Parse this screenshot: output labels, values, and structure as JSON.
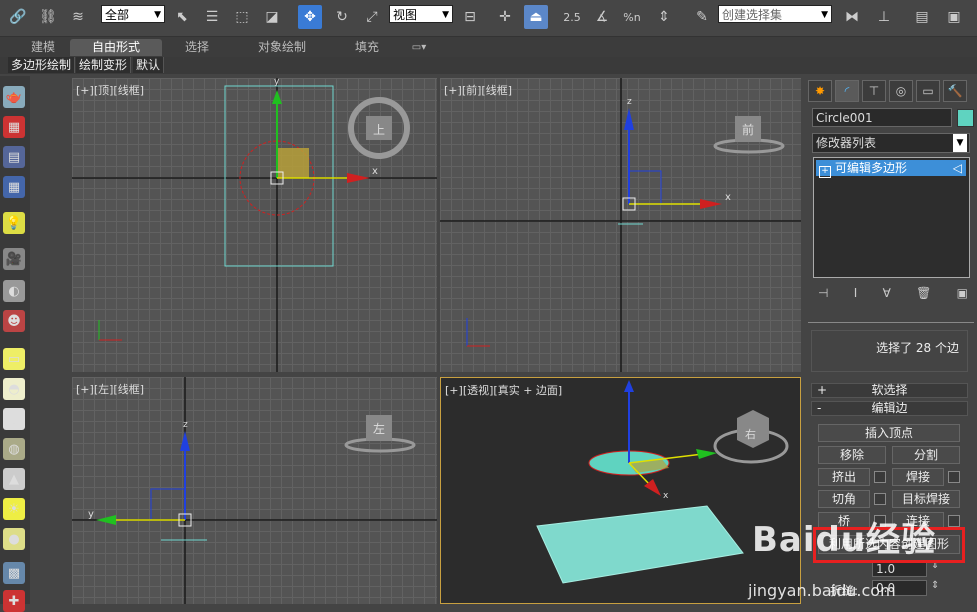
{
  "toolbar": {
    "selection_filter": "全部",
    "ref_coord": "视图",
    "named_selection": "创建选择集",
    "snap_2d_label": "2.5",
    "percent_snap_label": "%n"
  },
  "ribbon": {
    "tabs": [
      "建模",
      "自由形式",
      "选择",
      "对象绘制",
      "填充"
    ],
    "selected_tab": "自由形式",
    "subtabs": [
      "多边形绘制",
      "绘制变形",
      "默认"
    ]
  },
  "viewports": {
    "top": {
      "label_plus": "[+]",
      "label_view": "[顶]",
      "label_shade": "[线框]",
      "cube_label": "上"
    },
    "front": {
      "label_plus": "[+]",
      "label_view": "[前]",
      "label_shade": "[线框]",
      "cube_label": "前"
    },
    "left": {
      "label_plus": "[+]",
      "label_view": "[左]",
      "label_shade": "[线框]",
      "cube_label": "左"
    },
    "persp": {
      "label_plus": "[+]",
      "label_view": "[透视]",
      "label_shade": "[真实 + 边面]",
      "cube_label": "右"
    }
  },
  "axes": {
    "x": "x",
    "y": "y",
    "z": "z"
  },
  "command_panel": {
    "object_name": "Circle001",
    "object_color": "#5fd3c0",
    "modifier_list": "修改器列表",
    "stack_item": "可编辑多边形",
    "selection_info": "选择了 28 个边",
    "soft_selection": "软选择",
    "edit_edges": "编辑边",
    "insert_vertex": "插入顶点",
    "remove": "移除",
    "split": "分割",
    "extrude": "挤出",
    "weld": "焊接",
    "chamfer": "切角",
    "target_weld": "目标焊接",
    "bridge": "桥",
    "connect": "连接",
    "create_shape": "利用所选内容创建图形",
    "crease_label": "折缝:",
    "crease_value": "0.0",
    "weight_value": "1.0",
    "plus": "+",
    "minus": "-"
  },
  "watermark": {
    "logo": "Baidu经验",
    "url": "jingyan.baidu.com"
  }
}
